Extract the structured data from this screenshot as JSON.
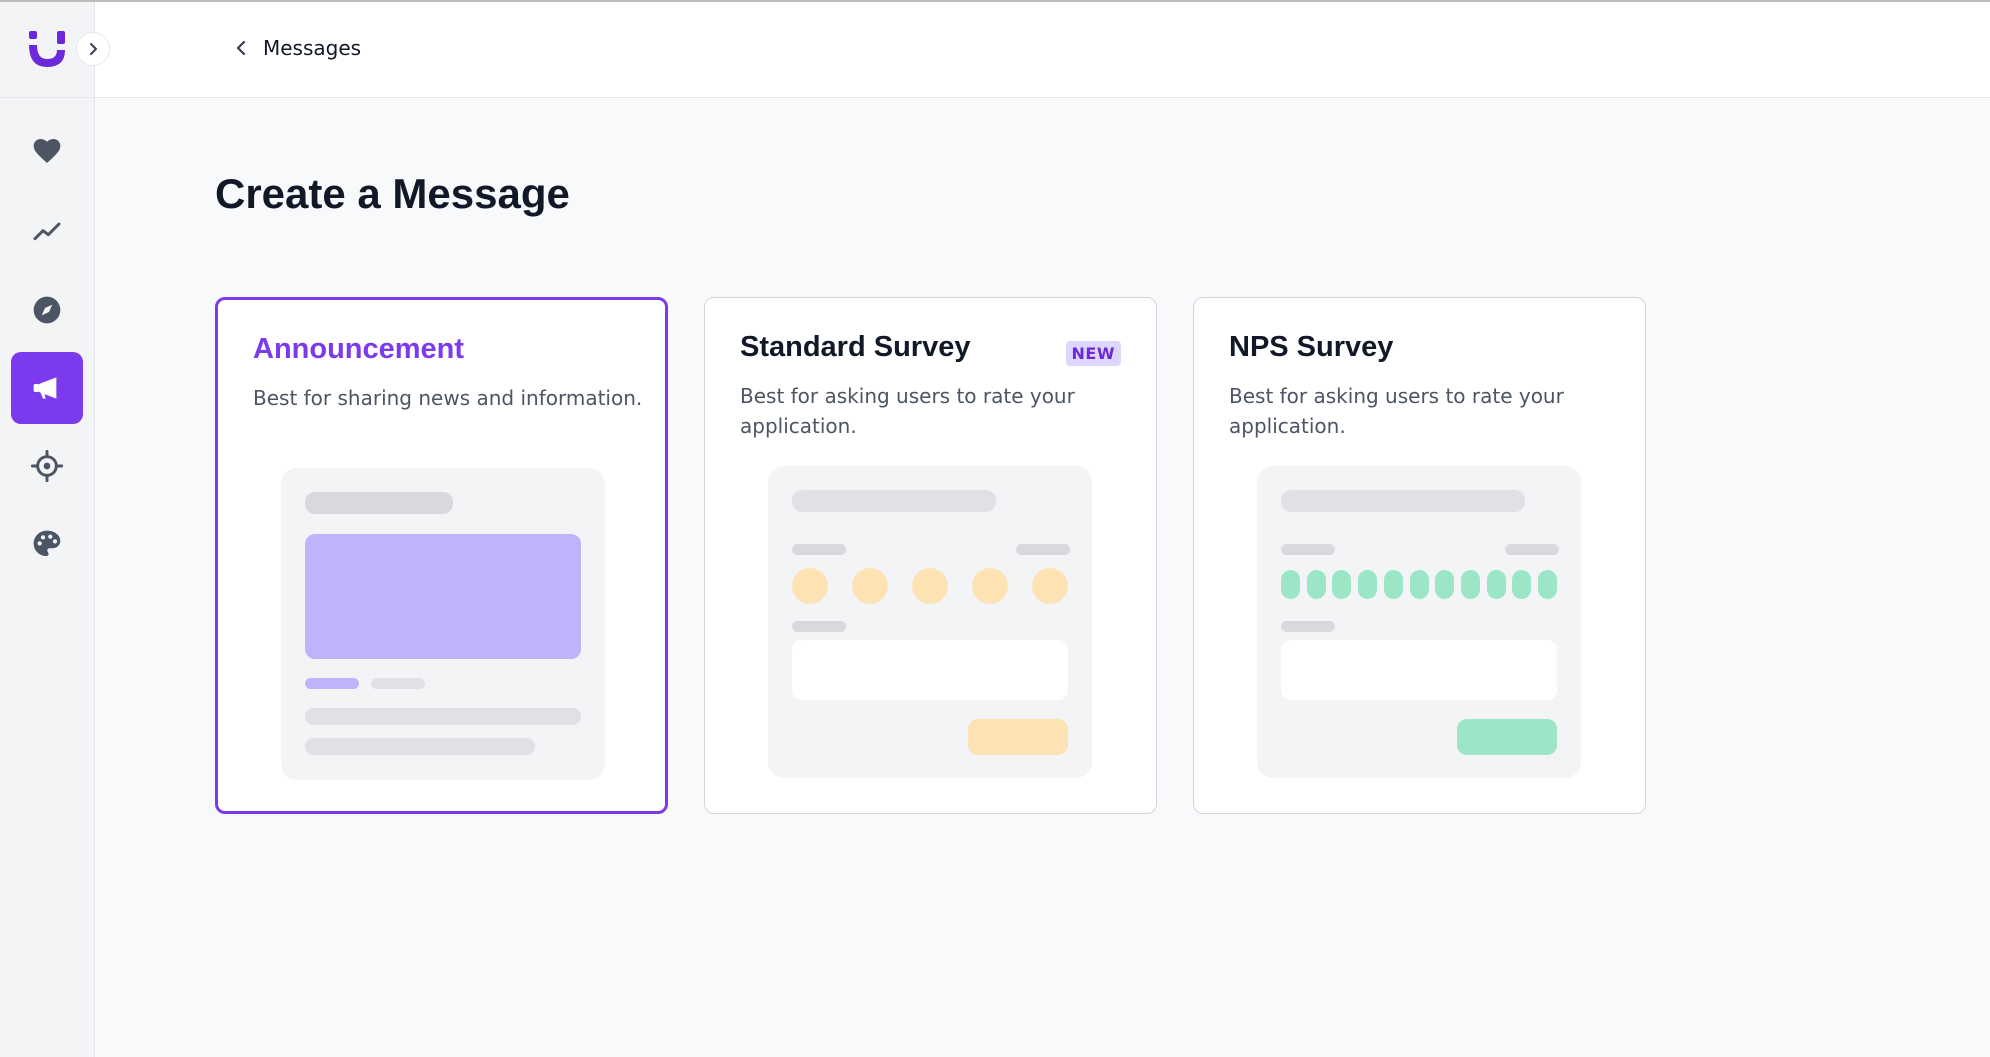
{
  "header": {
    "back_label": "Messages"
  },
  "sidebar": {
    "items": [
      {
        "icon": "heart-icon",
        "active": false
      },
      {
        "icon": "trend-line-icon",
        "active": false
      },
      {
        "icon": "compass-icon",
        "active": false
      },
      {
        "icon": "megaphone-icon",
        "active": true
      },
      {
        "icon": "crosshair-icon",
        "active": false
      },
      {
        "icon": "palette-icon",
        "active": false
      }
    ]
  },
  "main": {
    "title": "Create a Message",
    "cards": [
      {
        "title": "Announcement",
        "description": "Best for sharing news and information.",
        "selected": true
      },
      {
        "title": "Standard Survey",
        "badge": "NEW",
        "description": "Best for asking users to rate your application.",
        "selected": false
      },
      {
        "title": "NPS Survey",
        "description": "Best for asking users to rate your application.",
        "selected": false
      }
    ]
  },
  "colors": {
    "accent": "#7c3aed",
    "announcement_image": "#bdb4fb",
    "rating_circle": "#fde2b3",
    "nps_pill": "#9ae6c6"
  }
}
